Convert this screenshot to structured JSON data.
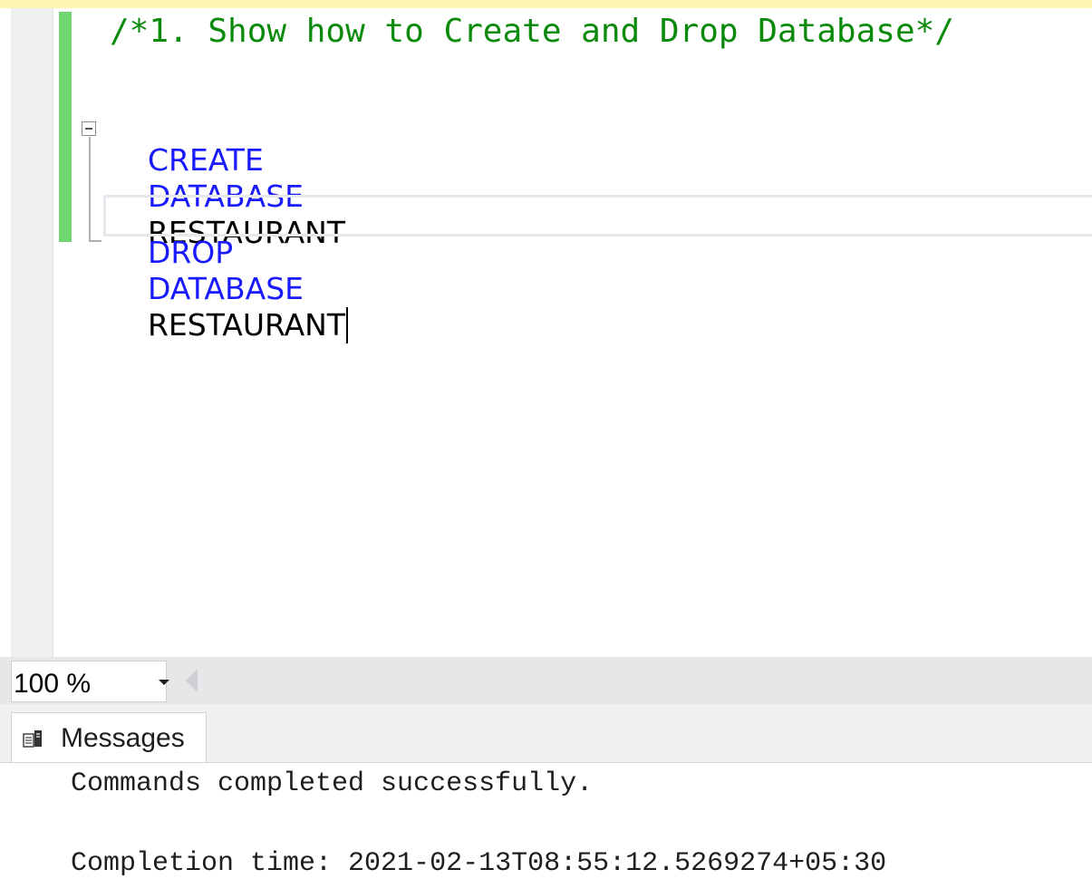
{
  "editor": {
    "comment_line": "/*1. Show how to Create and Drop Database*/",
    "create_keyword1": "CREATE",
    "create_keyword2": "DATABASE",
    "create_name": "RESTAURANT",
    "drop_keyword1": "DROP",
    "drop_keyword2": "DATABASE",
    "drop_name": "RESTAURANT"
  },
  "zoom": {
    "value": "100 %"
  },
  "results": {
    "tab_label": "Messages",
    "message_line1": "Commands completed successfully.",
    "message_line2": "Completion time: 2021-02-13T08:55:12.5269274+05:30"
  },
  "colors": {
    "keyword": "#1a1aff",
    "comment": "#0a8a0a",
    "change_bar": "#6fd66f"
  },
  "icons": [
    "fold-collapse-icon",
    "dropdown-arrow-icon",
    "scroll-left-icon",
    "messages-icon"
  ]
}
